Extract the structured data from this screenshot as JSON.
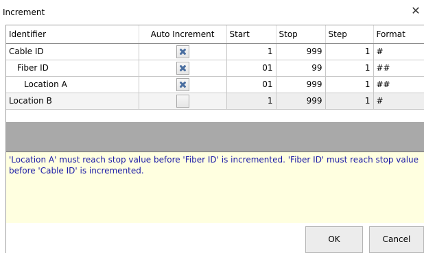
{
  "window": {
    "title": "Increment",
    "close_glyph": "✕"
  },
  "table": {
    "columns": [
      "Identifier",
      "Auto Increment",
      "Start",
      "Stop",
      "Step",
      "Format"
    ],
    "rows": [
      {
        "identifier": "Cable ID",
        "auto": true,
        "start": "1",
        "stop": "999",
        "step": "1",
        "format": "#"
      },
      {
        "identifier": "Fiber ID",
        "auto": true,
        "start": "01",
        "stop": "99",
        "step": "1",
        "format": "##"
      },
      {
        "identifier": "Location A",
        "auto": true,
        "start": "01",
        "stop": "999",
        "step": "1",
        "format": "##"
      },
      {
        "identifier": "Location B",
        "auto": false,
        "start": "1",
        "stop": "999",
        "step": "1",
        "format": "#"
      }
    ]
  },
  "message": "'Location A' must reach stop value before 'Fiber ID' is incremented.  'Fiber ID' must reach stop value before 'Cable ID' is incremented.",
  "buttons": {
    "ok": "OK",
    "cancel": "Cancel"
  },
  "colors": {
    "message_text": "#1a1aa6",
    "message_bg": "#ffffe0",
    "check_mark": "#4a6ea0"
  }
}
